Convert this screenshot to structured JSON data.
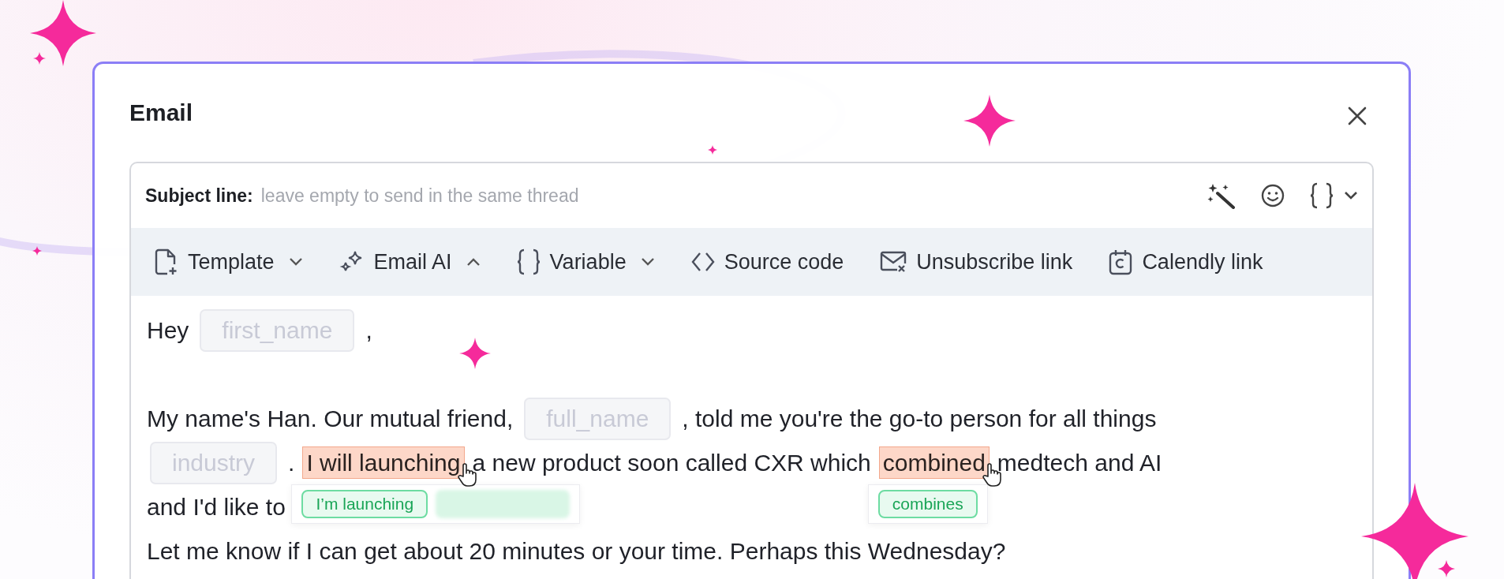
{
  "dialog": {
    "title": "Email"
  },
  "subject": {
    "label": "Subject line:",
    "placeholder": "leave empty to send in the same thread"
  },
  "toolbar": [
    {
      "label": "Template",
      "expanded": false
    },
    {
      "label": "Email AI",
      "expanded": true
    },
    {
      "label": "Variable",
      "expanded": false
    },
    {
      "label": "Source code"
    },
    {
      "label": "Unsubscribe link"
    },
    {
      "label": "Calendly link"
    }
  ],
  "body": [
    {
      "lines": [
        {
          "segments": [
            {
              "kind": "text",
              "text": "Hey"
            },
            {
              "kind": "variable",
              "text": "first_name"
            },
            {
              "kind": "text",
              "text": ","
            }
          ]
        }
      ]
    },
    {
      "lines": [
        {
          "segments": [
            {
              "kind": "text",
              "text": "My name's Han. Our mutual friend,"
            },
            {
              "kind": "variable",
              "text": "full_name"
            },
            {
              "kind": "text",
              "text": ", told me you're the go-to person for all things"
            }
          ]
        },
        {
          "segments": [
            {
              "kind": "variable",
              "text": "industry"
            },
            {
              "kind": "text",
              "text": "."
            },
            {
              "kind": "error",
              "text": "I will launching",
              "suggestions": [
                "I’m launching"
              ]
            },
            {
              "kind": "text",
              "text": "a new product soon called CXR which"
            },
            {
              "kind": "error",
              "text": "combined",
              "suggestions": [
                "combines"
              ]
            },
            {
              "kind": "text",
              "text": "medtech and AI"
            }
          ]
        },
        {
          "segments": [
            {
              "kind": "text",
              "text": "and I'd like to"
            }
          ]
        },
        {
          "segments": [
            {
              "kind": "text",
              "text": "Let me know if I can get about 20 minutes or your time. Perhaps this Wednesday?"
            }
          ]
        }
      ]
    }
  ]
}
